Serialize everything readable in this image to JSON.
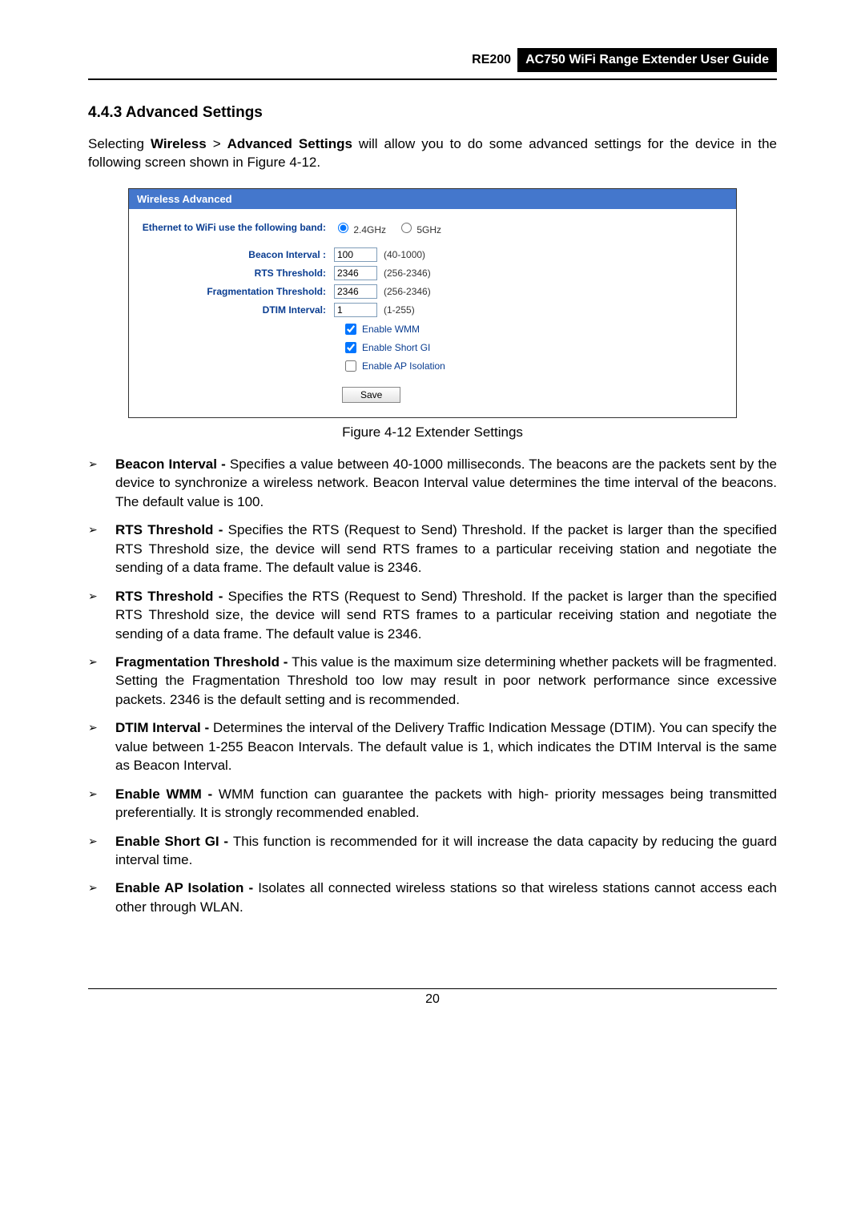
{
  "header": {
    "model": "RE200",
    "guide": "AC750 WiFi Range Extender User Guide"
  },
  "section": {
    "number_title": "4.4.3  Advanced Settings",
    "intro_pre": "Selecting ",
    "intro_b1": "Wireless",
    "intro_mid": " > ",
    "intro_b2": "Advanced Settings",
    "intro_post": " will allow you to do some advanced settings for the device in the following screen shown in Figure 4-12."
  },
  "panel": {
    "title": "Wireless Advanced",
    "ethernet_label": "Ethernet to WiFi use the following band:",
    "band_24": "2.4GHz",
    "band_5": "5GHz",
    "beacon_label": "Beacon Interval :",
    "beacon_val": "100",
    "beacon_range": "(40-1000)",
    "rts_label": "RTS Threshold:",
    "rts_val": "2346",
    "rts_range": "(256-2346)",
    "frag_label": "Fragmentation Threshold:",
    "frag_val": "2346",
    "frag_range": "(256-2346)",
    "dtim_label": "DTIM Interval:",
    "dtim_val": "1",
    "dtim_range": "(1-255)",
    "enable_wmm": "Enable WMM",
    "enable_short_gi": "Enable Short GI",
    "enable_ap_iso": "Enable AP Isolation",
    "save": "Save"
  },
  "figure_caption": "Figure 4-12 Extender Settings",
  "bullets": [
    {
      "title": "Beacon Interval - ",
      "text": "Specifies a value between 40-1000 milliseconds. The beacons are the packets sent by the device to synchronize a wireless network. Beacon Interval value determines the time interval of the beacons. The default value is 100."
    },
    {
      "title": "RTS Threshold - ",
      "text": "Specifies the RTS (Request to Send) Threshold. If the packet is larger than the specified RTS Threshold size, the device will send RTS frames to a particular receiving station and negotiate the sending of a data frame. The default value is 2346."
    },
    {
      "title": "RTS Threshold - ",
      "text": "Specifies the RTS (Request to Send) Threshold. If the packet is larger than the specified RTS Threshold size, the device will send RTS frames to a particular receiving station and negotiate the sending of a data frame. The default value is 2346."
    },
    {
      "title": "Fragmentation Threshold - ",
      "text": "This value is the maximum size determining whether packets will be fragmented. Setting the Fragmentation Threshold too low may result in poor network performance since excessive packets. 2346 is the default setting and is recommended."
    },
    {
      "title": "DTIM Interval - ",
      "text": "Determines the interval of the Delivery Traffic Indication Message (DTIM). You can specify the value between 1-255 Beacon Intervals. The default value is 1, which indicates the DTIM Interval is the same as Beacon Interval."
    },
    {
      "title": "Enable WMM - ",
      "text": "WMM function can guarantee the packets with high- priority messages being transmitted preferentially. It is strongly recommended enabled."
    },
    {
      "title": "Enable Short GI - ",
      "text": "This function is recommended for it will increase the data capacity by reducing the guard interval time."
    },
    {
      "title": "Enable AP Isolation - ",
      "text": "Isolates all connected wireless stations so that wireless stations cannot access each other through WLAN."
    }
  ],
  "page_number": "20"
}
